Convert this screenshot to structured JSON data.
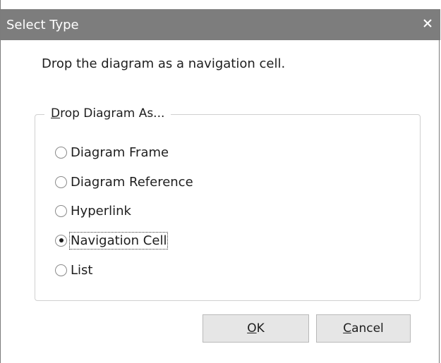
{
  "window": {
    "title": "Select Type",
    "close_symbol": "×"
  },
  "prompt": "Drop the diagram as a navigation cell.",
  "group": {
    "legend_accel": "D",
    "legend_rest": "rop Diagram As..."
  },
  "options": [
    {
      "label": "Diagram Frame",
      "selected": false
    },
    {
      "label": "Diagram Reference",
      "selected": false
    },
    {
      "label": "Hyperlink",
      "selected": false
    },
    {
      "label": "Navigation Cell",
      "selected": true
    },
    {
      "label": "List",
      "selected": false
    }
  ],
  "buttons": {
    "ok_accel": "O",
    "ok_rest": "K",
    "cancel_accel": "C",
    "cancel_rest": "ancel"
  },
  "icons": {
    "close": "close-icon"
  },
  "colors": {
    "titlebar": "#7d7d7d",
    "button_face": "#e6e6e6",
    "group_border": "#d0d0d0"
  }
}
